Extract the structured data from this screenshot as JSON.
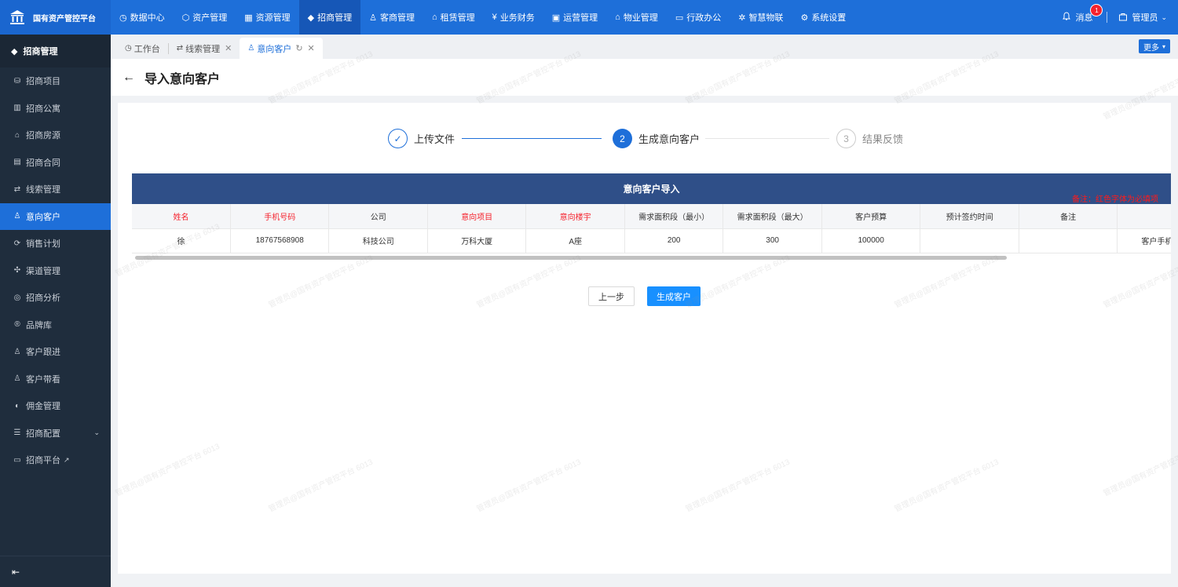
{
  "brand": {
    "name": "国有资产管控平台",
    "logo_icon": "bank-icon"
  },
  "topnav": [
    {
      "label": "数据中心",
      "icon": "dashboard-icon"
    },
    {
      "label": "资产管理",
      "icon": "cube-icon"
    },
    {
      "label": "资源管理",
      "icon": "building-icon"
    },
    {
      "label": "招商管理",
      "icon": "tag-icon",
      "active": true
    },
    {
      "label": "客商管理",
      "icon": "users-icon"
    },
    {
      "label": "租赁管理",
      "icon": "home-icon"
    },
    {
      "label": "业务财务",
      "icon": "yen-icon"
    },
    {
      "label": "运营管理",
      "icon": "monitor-icon"
    },
    {
      "label": "物业管理",
      "icon": "house-icon"
    },
    {
      "label": "行政办公",
      "icon": "desktop-icon"
    },
    {
      "label": "智慧物联",
      "icon": "iot-icon"
    },
    {
      "label": "系统设置",
      "icon": "gear-icon"
    }
  ],
  "header_right": {
    "message_label": "消息",
    "message_count": "1",
    "user_label": "管理员"
  },
  "sidebar": {
    "title": "招商管理",
    "items": [
      {
        "label": "招商项目"
      },
      {
        "label": "招商公寓"
      },
      {
        "label": "招商房源"
      },
      {
        "label": "招商合同"
      },
      {
        "label": "线索管理"
      },
      {
        "label": "意向客户",
        "active": true
      },
      {
        "label": "销售计划"
      },
      {
        "label": "渠道管理"
      },
      {
        "label": "招商分析"
      },
      {
        "label": "品牌库"
      },
      {
        "label": "客户跟进"
      },
      {
        "label": "客户带看"
      },
      {
        "label": "佣金管理"
      },
      {
        "label": "招商配置"
      },
      {
        "label": "招商平台"
      }
    ]
  },
  "tabs": [
    {
      "label": "工作台"
    },
    {
      "label": "线索管理"
    },
    {
      "label": "意向客户",
      "active": true
    }
  ],
  "more_label": "更多",
  "page": {
    "title": "导入意向客户"
  },
  "steps": [
    {
      "num": "✓",
      "label": "上传文件",
      "state": "done"
    },
    {
      "num": "2",
      "label": "生成意向客户",
      "state": "current"
    },
    {
      "num": "3",
      "label": "结果反馈",
      "state": "wait"
    }
  ],
  "import_table": {
    "title": "意向客户导入",
    "note": "备注：红色字体为必填项",
    "columns": [
      {
        "label": "姓名",
        "required": true
      },
      {
        "label": "手机号码",
        "required": true
      },
      {
        "label": "公司",
        "required": false
      },
      {
        "label": "意向项目",
        "required": true
      },
      {
        "label": "意向楼宇",
        "required": true
      },
      {
        "label": "需求面积段（最小）",
        "required": false
      },
      {
        "label": "需求面积段（最大）",
        "required": false
      },
      {
        "label": "客户预算",
        "required": false
      },
      {
        "label": "预计签约时间",
        "required": false
      },
      {
        "label": "备注",
        "required": false
      },
      {
        "label": "",
        "required": false
      }
    ],
    "rows": [
      [
        "徐",
        "18767568908",
        "科技公司",
        "万科大厦",
        "A座",
        "200",
        "300",
        "100000",
        "",
        "",
        "客户手机号在列为已经存"
      ]
    ]
  },
  "buttons": {
    "prev": "上一步",
    "generate": "生成客户"
  },
  "watermark": "管理员@国有资产管控平台 6013",
  "colors": {
    "primary": "#1e6fd9",
    "sidebar_bg": "#1f2d3d",
    "table_header_bg": "#2f4f88",
    "required_red": "#f5222d"
  }
}
